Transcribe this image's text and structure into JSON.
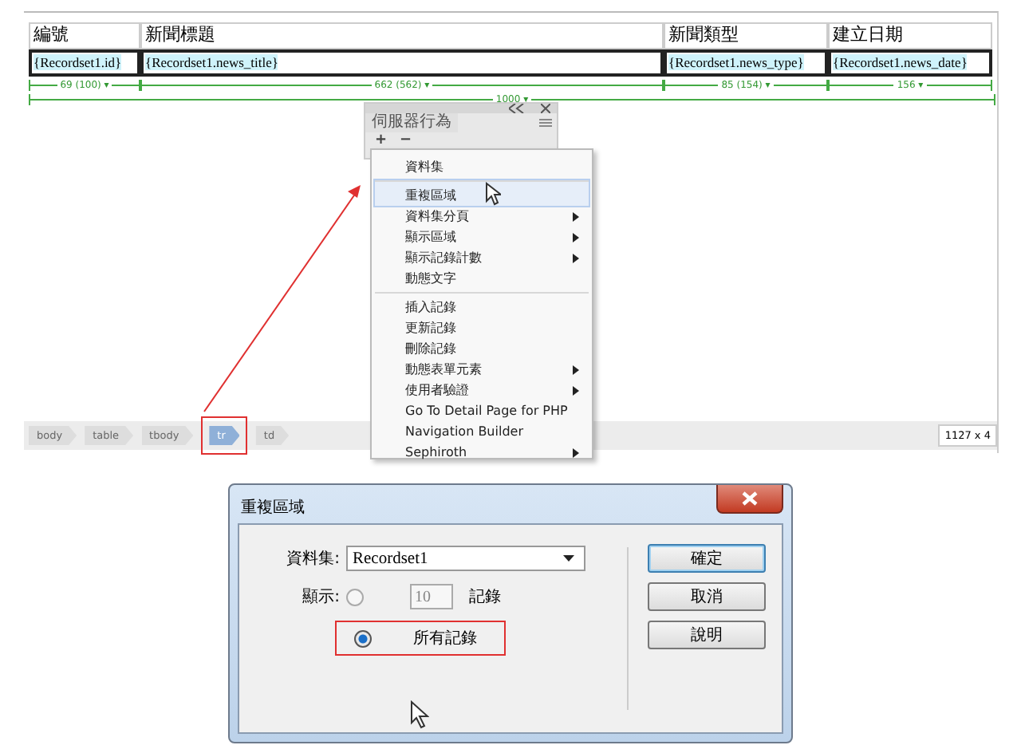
{
  "document": {
    "table": {
      "columns": [
        "編號",
        "新聞標題",
        "新聞類型",
        "建立日期"
      ],
      "rows": [
        [
          "{Recordset1.id}",
          "{Recordset1.news_title}",
          "{Recordset1.news_type}",
          "{Recordset1.news_date}"
        ]
      ]
    },
    "column_widths": [
      "69 (100) ▾",
      "662 (562) ▾",
      "85 (154) ▾",
      "156 ▾"
    ],
    "table_width": "1000 ▾"
  },
  "panel": {
    "title": "伺服器行為",
    "add": "+",
    "remove": "−"
  },
  "menu": {
    "items": [
      {
        "label": "資料集",
        "submenu": false,
        "selected": false,
        "group_start": false
      },
      {
        "label": "重複區域",
        "submenu": false,
        "selected": true,
        "group_start": true
      },
      {
        "label": "資料集分頁",
        "submenu": true,
        "selected": false,
        "group_start": false
      },
      {
        "label": "顯示區域",
        "submenu": true,
        "selected": false,
        "group_start": false
      },
      {
        "label": "顯示記錄計數",
        "submenu": true,
        "selected": false,
        "group_start": false
      },
      {
        "label": "動態文字",
        "submenu": false,
        "selected": false,
        "group_start": false
      },
      {
        "label": "插入記錄",
        "submenu": false,
        "selected": false,
        "group_start": true
      },
      {
        "label": "更新記錄",
        "submenu": false,
        "selected": false,
        "group_start": false
      },
      {
        "label": "刪除記錄",
        "submenu": false,
        "selected": false,
        "group_start": false
      },
      {
        "label": "動態表單元素",
        "submenu": true,
        "selected": false,
        "group_start": false
      },
      {
        "label": "使用者驗證",
        "submenu": true,
        "selected": false,
        "group_start": false
      },
      {
        "label": "Go To Detail Page for PHP",
        "submenu": false,
        "selected": false,
        "group_start": false
      },
      {
        "label": "Navigation Builder",
        "submenu": false,
        "selected": false,
        "group_start": false
      },
      {
        "label": "Sephiroth",
        "submenu": true,
        "selected": false,
        "group_start": false
      }
    ]
  },
  "tag_selector": [
    {
      "label": "body",
      "selected": false
    },
    {
      "label": "table",
      "selected": false
    },
    {
      "label": "tbody",
      "selected": false
    },
    {
      "label": "tr",
      "selected": true
    },
    {
      "label": "td",
      "selected": false
    }
  ],
  "window_size": "1127 x 4",
  "dialog": {
    "title": "重複區域",
    "recordset_label": "資料集:",
    "recordset_value": "Recordset1",
    "show_label": "顯示:",
    "options": [
      {
        "kind": "count",
        "selected": false,
        "value": "10",
        "suffix": "記錄"
      },
      {
        "kind": "all",
        "selected": true,
        "label": "所有記錄"
      }
    ],
    "buttons": [
      {
        "label": "確定",
        "focused": true
      },
      {
        "label": "取消",
        "focused": false
      },
      {
        "label": "說明",
        "focused": false
      }
    ]
  }
}
